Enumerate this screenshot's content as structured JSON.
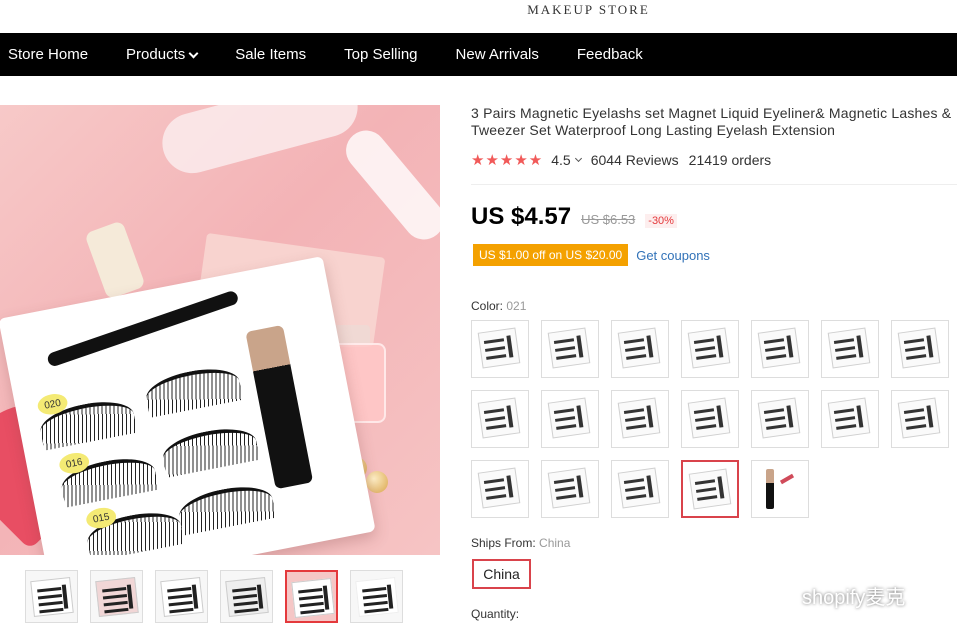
{
  "store": {
    "title": "MAKEUP STORE"
  },
  "nav": {
    "items": [
      {
        "label": "Store Home"
      },
      {
        "label": "Products",
        "has_dropdown": true
      },
      {
        "label": "Sale Items"
      },
      {
        "label": "Top Selling"
      },
      {
        "label": "New Arrivals"
      },
      {
        "label": "Feedback"
      }
    ]
  },
  "hero": {
    "tags": [
      "020",
      "016",
      "015"
    ]
  },
  "product": {
    "title": "3 Pairs Magnetic Eyelashs set Magnet Liquid Eyeliner& Magnetic Lashes & Tweezer Set Waterproof Long Lasting Eyelash Extension",
    "stars": "★★★★★",
    "rating": "4.5",
    "reviews": "6044 Reviews",
    "orders": "21419 orders",
    "price": "US $4.57",
    "original_price": "US $6.53",
    "discount": "-30%",
    "coupon": "US $1.00 off on US $20.00",
    "coupon_link": "Get coupons",
    "color_label": "Color:",
    "color_value": "021",
    "ships_from_label": "Ships From:",
    "ships_from_value": "China",
    "ships_option": "China",
    "quantity_label": "Quantity:",
    "selected_swatch_index": 17,
    "swatch_count": 19,
    "selected_thumbnail_index": 4
  },
  "watermark": {
    "text": "shopify麦克"
  },
  "colors": {
    "accent_red": "#e4393c",
    "coupon_orange": "#f4a100",
    "link_blue": "#3172b8",
    "nav_bg": "#000000"
  }
}
